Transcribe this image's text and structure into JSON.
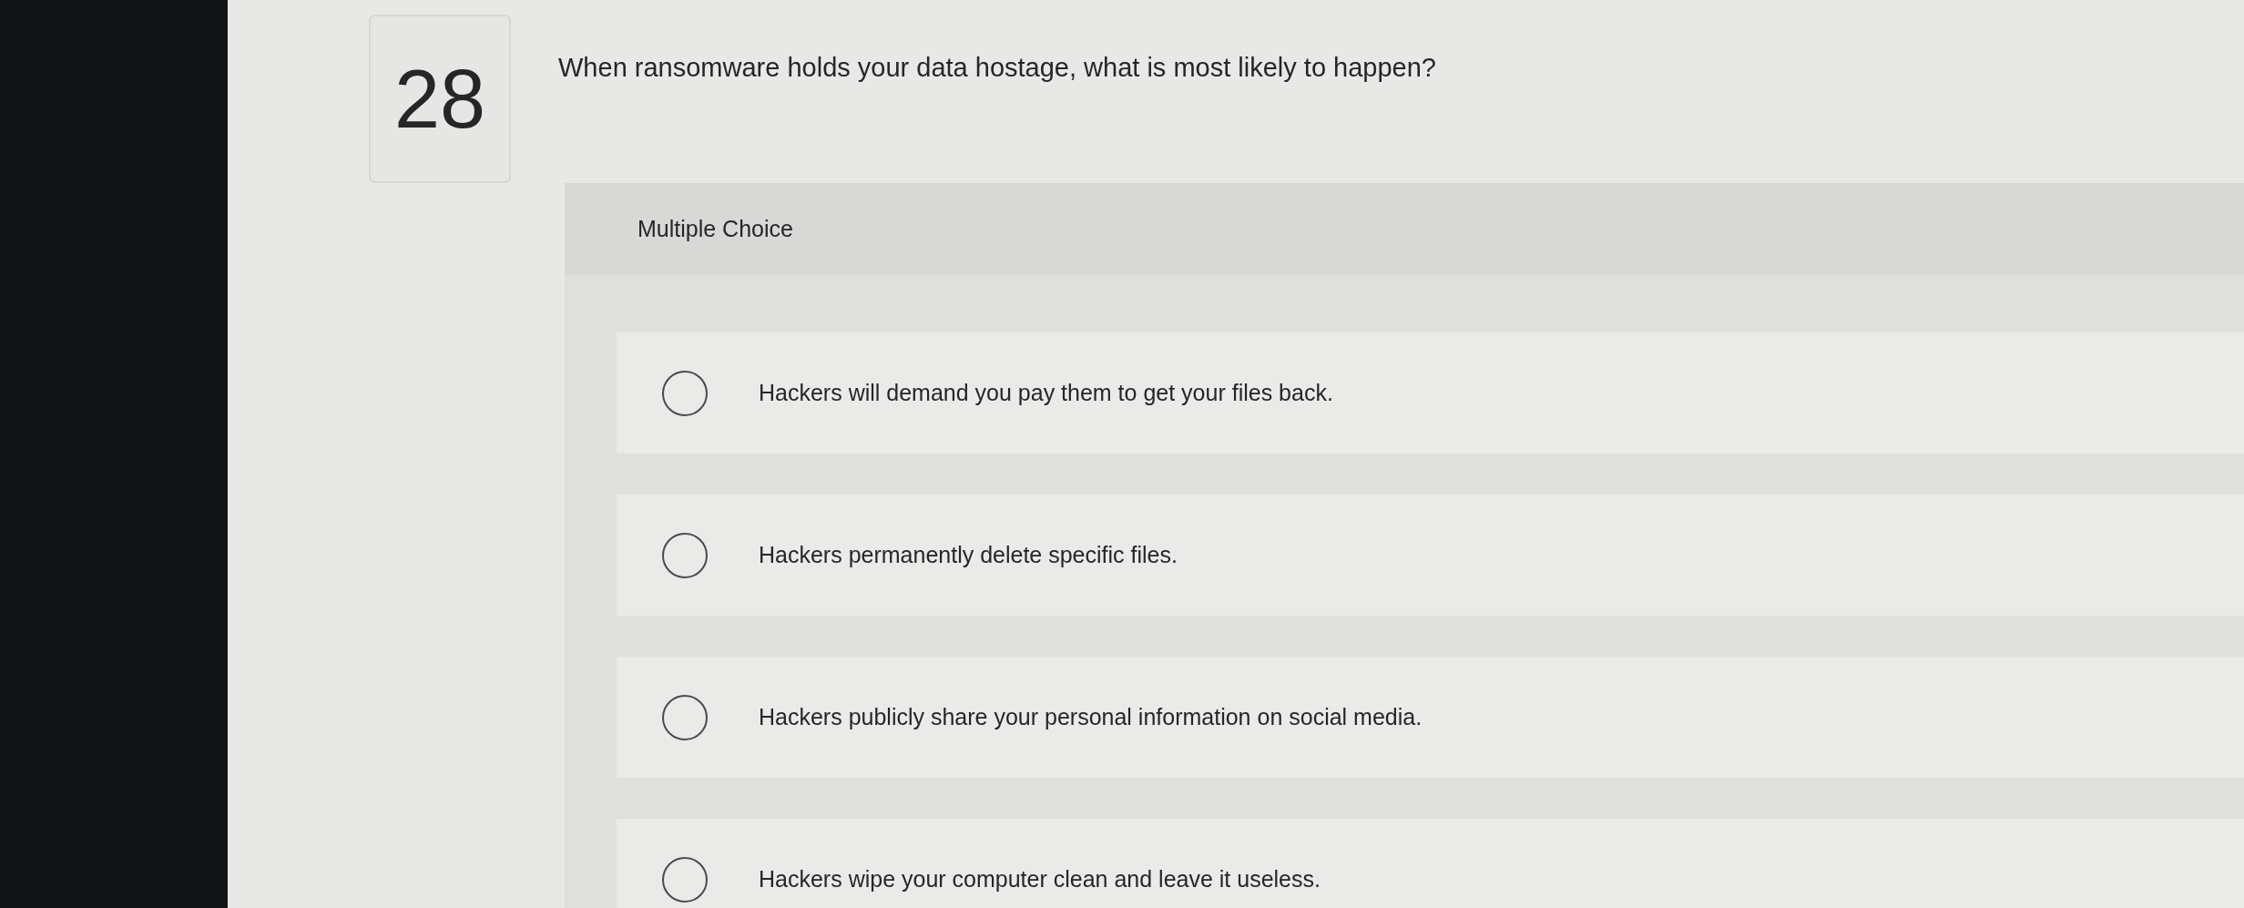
{
  "question": {
    "number": "28",
    "text": "When ransomware holds your data hostage, what is most likely to happen?"
  },
  "answer_panel": {
    "type_label": "Multiple Choice",
    "options": [
      {
        "label": "Hackers will demand you pay them to get your files back.",
        "selected": false
      },
      {
        "label": "Hackers permanently delete specific files.",
        "selected": false
      },
      {
        "label": "Hackers publicly share your personal information on social media.",
        "selected": false
      },
      {
        "label": "Hackers wipe your computer clean and leave it useless.",
        "selected": false
      }
    ]
  }
}
